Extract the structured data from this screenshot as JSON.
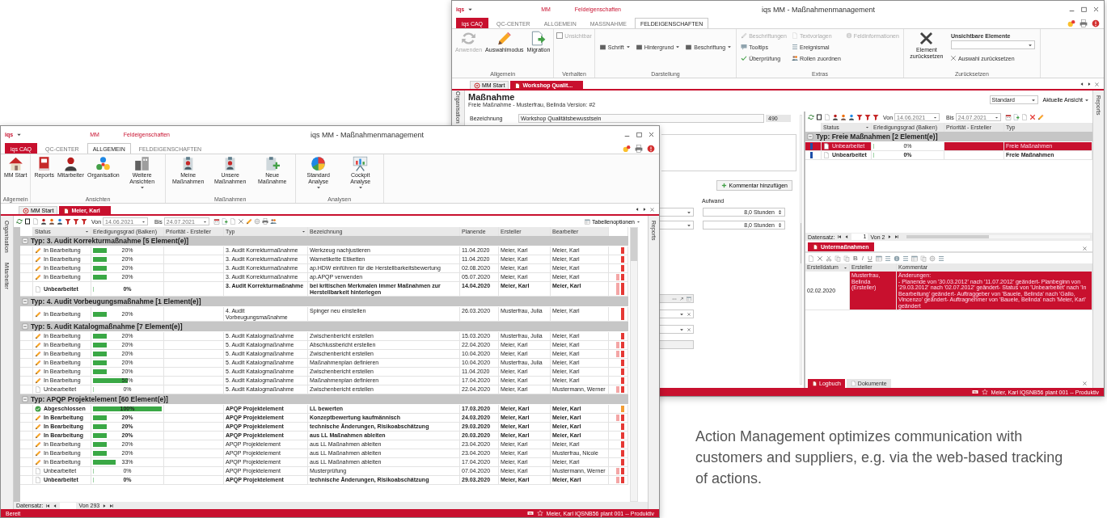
{
  "back_window": {
    "logo": "iqs",
    "context_labels": [
      "MM",
      "Feldeigenschaften"
    ],
    "title": "iqs MM - Maßnahmenmanagement",
    "ribbon_tabs": [
      {
        "label": "iqs CAQ",
        "kind": "app",
        "selected": false
      },
      {
        "label": "QC-CENTER",
        "kind": "tab",
        "selected": false
      },
      {
        "label": "ALLGEMEIN",
        "kind": "tab",
        "selected": false
      },
      {
        "label": "MASSNAHME",
        "kind": "tab",
        "selected": false
      },
      {
        "label": "FELDEIGENSCHAFTEN",
        "kind": "tab",
        "selected": true
      }
    ],
    "ribbon_groups": [
      {
        "label": "Allgemein",
        "items": [
          {
            "kind": "large",
            "label": "Anwenden",
            "disabled": true
          },
          {
            "kind": "large",
            "label": "Auswahlmodus",
            "disabled": false
          },
          {
            "kind": "large",
            "label": "Migration",
            "disabled": false
          }
        ]
      },
      {
        "label": "Verhalten",
        "items": [
          {
            "kind": "check",
            "label": "Unsichtbar",
            "checked": false,
            "disabled": true
          }
        ]
      },
      {
        "label": "Darstellung",
        "items": [
          {
            "kind": "dropdown",
            "label": "Schrift",
            "disabled": false
          },
          {
            "kind": "dropdown",
            "label": "Hintergrund",
            "disabled": false
          },
          {
            "kind": "dropdown",
            "label": "Beschriftung",
            "disabled": false
          }
        ]
      },
      {
        "label": "Extras",
        "items": [
          {
            "kind": "small",
            "label": "Beschriftungen",
            "disabled": true
          },
          {
            "kind": "small",
            "label": "Tooltips",
            "disabled": false
          },
          {
            "kind": "small",
            "label": "Überprüfung",
            "disabled": false
          },
          {
            "kind": "small",
            "label": "Textvorlagen",
            "disabled": true
          },
          {
            "kind": "small",
            "label": "Ereignismal",
            "disabled": false
          },
          {
            "kind": "small",
            "label": "Rollen zuordnen",
            "disabled": false
          },
          {
            "kind": "small",
            "label": "Feldinformationen",
            "disabled": true
          }
        ]
      },
      {
        "label": "Zurücksetzen",
        "items": [
          {
            "kind": "large",
            "label": "Element zurücksetzen",
            "disabled": false
          },
          {
            "kind": "combo",
            "label": "Unsichtbare Elemente",
            "disabled": false
          },
          {
            "kind": "small",
            "label": "Auswahl zurücksetzen",
            "disabled": false
          }
        ]
      }
    ],
    "doc_tabs": [
      {
        "label": "MM Start",
        "selected": false
      },
      {
        "label": "Workshop Qualit...",
        "selected": true
      }
    ],
    "side_tab": "Organisation",
    "right_tab": "Reports",
    "heading": "Maßnahme",
    "subtitle": "Freie Maßnahme - Musterfrau, Belinda Version: #2",
    "view_select": "Standard",
    "view_menu": "Aktuelle Ansicht",
    "form": {
      "name_label": "Bezeichnung",
      "name_value": "Workshop Qualitätsbewusstsein",
      "counter": "490",
      "add_comment": "Kommentar hinzufügen",
      "effort_label": "Aufwand",
      "effort_values": [
        "8,0 Stunden",
        "8,0 Stunden"
      ]
    },
    "grid": {
      "toolbar": {
        "from_label": "Von",
        "from": "14.06.2021",
        "to_label": "Bis",
        "to": "24.07.2021"
      },
      "columns": [
        {
          "label": "Status",
          "filter": true
        },
        {
          "label": "Erledigungsgrad (Balken)",
          "filter": false
        },
        {
          "label": "Priorität - Ersteller",
          "filter": false
        },
        {
          "label": "Typ",
          "filter": false
        }
      ],
      "group": {
        "label": "Typ: Freie Maßnahmen [2 Element(e)]",
        "expanded": true,
        "rows": [
          {
            "kind": "open",
            "status": "Unbearbeitet",
            "level": 0,
            "percent": "0%",
            "type": "Freie Maßnahmen",
            "bold": false,
            "selected": true
          },
          {
            "kind": "open",
            "status": "Unbearbeitet",
            "level": 0,
            "percent": "0%",
            "type": "Freie Maßnahmen",
            "bold": true,
            "selected": false
          }
        ]
      },
      "pager": {
        "label": "Datensatz:",
        "page": "1",
        "of": "Von 2"
      }
    },
    "sub": {
      "tab": "Untermaßnahmen",
      "format_buttons": [
        "B",
        "I",
        "U"
      ],
      "columns": [
        {
          "label": "Erstelldatum",
          "filter": true
        },
        {
          "label": "Ersteller",
          "filter": false
        },
        {
          "label": "Kommentar",
          "filter": false
        }
      ],
      "rows": [
        {
          "date": "02.02.2020",
          "creator": "Musterfrau, Belinda (Ersteller)",
          "comment": "Änderungen:\n - Planende von '30.03.2012' nach '11.07.2012' geändert- Planbeginn von '29.03.2012' nach '02.07.2012' geändert- Status von 'Unbearbeitet' nach 'In Bearbeitung' geändert- Auftraggeber von 'Bauele, Belinda' nach 'Gallo, Vincenzo' geändert- Auftragnehmer von 'Bauele, Belinda' nach 'Meier, Karl' geändert",
          "selected": true
        }
      ]
    },
    "bottom_tabs": [
      {
        "label": "Logbuch",
        "selected": true
      },
      {
        "label": "Dokumente",
        "selected": false
      }
    ],
    "status_bar": {
      "right": "Meier, Karl  IQSNB56  plant 001  --  Produktiv"
    }
  },
  "front_window": {
    "logo": "iqs",
    "context_labels": [
      "MM",
      "Feldeigenschaften"
    ],
    "title": "iqs MM - Maßnahmenmanagement",
    "ribbon_tabs": [
      {
        "label": "iqs CAQ",
        "kind": "app",
        "selected": false
      },
      {
        "label": "QC-CENTER",
        "kind": "tab",
        "selected": false
      },
      {
        "label": "ALLGEMEIN",
        "kind": "tab",
        "selected": true
      },
      {
        "label": "FELDEIGENSCHAFTEN",
        "kind": "tab",
        "selected": false
      }
    ],
    "ribbon_groups": [
      {
        "label": "Allgemein",
        "items": [
          {
            "kind": "large",
            "label": "MM Start",
            "menu": false
          }
        ]
      },
      {
        "label": "Ansichten",
        "items": [
          {
            "kind": "large",
            "label": "Reports",
            "menu": false
          },
          {
            "kind": "large",
            "label": "Mitarbeiter",
            "menu": false
          },
          {
            "kind": "large",
            "label": "Organisation",
            "menu": false
          },
          {
            "kind": "large",
            "label": "Weitere Ansichten",
            "menu": true
          }
        ]
      },
      {
        "label": "Maßnahmen",
        "items": [
          {
            "kind": "large",
            "label": "Meine Maßnahmen",
            "menu": false
          },
          {
            "kind": "large",
            "label": "Unsere Maßnahmen",
            "menu": false
          },
          {
            "kind": "large",
            "label": "Neue Maßnahme",
            "menu": false
          }
        ]
      },
      {
        "label": "Analysen",
        "items": [
          {
            "kind": "large",
            "label": "Standard Analyse",
            "menu": true
          },
          {
            "kind": "large",
            "label": "Cockpit Analyse",
            "menu": true
          }
        ]
      }
    ],
    "doc_tabs": [
      {
        "label": "MM Start",
        "selected": false
      },
      {
        "label": "Meier, Karl",
        "selected": true
      }
    ],
    "side_tabs": [
      "Organisation",
      "Mitarbeiter"
    ],
    "right_tab": "Reports",
    "toolbar": {
      "from_label": "Von",
      "from": "14.06.2021",
      "to_label": "Bis",
      "to": "24.07.2021",
      "options": "Tabellenoptionen"
    },
    "columns": [
      {
        "label": "Status",
        "filter": true
      },
      {
        "label": "Erledigungsgrad (Balken)",
        "filter": false
      },
      {
        "label": "Priorität - Ersteller",
        "filter": false
      },
      {
        "label": "Typ",
        "filter": true
      },
      {
        "label": "Bezeichnung",
        "filter": false
      },
      {
        "label": "Planende",
        "filter": false
      },
      {
        "label": "Ersteller",
        "filter": false
      },
      {
        "label": "Bearbeiter",
        "filter": false
      }
    ],
    "groups": [
      {
        "label": "Typ: 3. Audit Korrekturmaßnahme [5 Element(e)]",
        "expanded": true,
        "rows": [
          {
            "kind": "in_progress",
            "status": "In Bearbeitung",
            "level": 0.2,
            "percent": "20%",
            "type": "3. Audit Korrekturmaßnahme",
            "title": "Werkzeug nachjustieren",
            "due": "11.04.2020",
            "creator": "Meier, Karl",
            "assignee": "Meier, Karl",
            "bold": false,
            "flagged": false,
            "color": "#e53935"
          },
          {
            "kind": "in_progress",
            "status": "In Bearbeitung",
            "level": 0.2,
            "percent": "20%",
            "type": "3. Audit Korrekturmaßnahme",
            "title": "Warnetikette Etiketten",
            "due": "11.04.2020",
            "creator": "Meier, Karl",
            "assignee": "Meier, Karl",
            "bold": false,
            "flagged": false,
            "color": "#e53935"
          },
          {
            "kind": "in_progress",
            "status": "In Bearbeitung",
            "level": 0.2,
            "percent": "20%",
            "type": "3. Audit Korrekturmaßnahme",
            "title": "ap.HDW einführen für die Herstellbarkeitsbewertung",
            "due": "02.08.2020",
            "creator": "Meier, Karl",
            "assignee": "Meier, Karl",
            "bold": false,
            "flagged": false,
            "color": "#e53935"
          },
          {
            "kind": "in_progress",
            "status": "In Bearbeitung",
            "level": 0.2,
            "percent": "20%",
            "type": "3. Audit Korrekturmaßnahme",
            "title": "ap.APQP verwenden",
            "due": "05.07.2020",
            "creator": "Meier, Karl",
            "assignee": "Meier, Karl",
            "bold": false,
            "flagged": true,
            "color": "#e53935"
          },
          {
            "kind": "open",
            "status": "Unbearbeitet",
            "level": 0,
            "percent": "0%",
            "type": "3. Audit Korrekturmaßnahme",
            "title": "bei kritischen Merkmalen immer Maßnahmen zur Herstellbarkeit hinterlegen",
            "due": "14.04.2020",
            "creator": "Meier, Karl",
            "assignee": "Meier, Karl",
            "bold": true,
            "flagged": true,
            "color": "#e53935"
          }
        ]
      },
      {
        "label": "Typ: 4. Audit Vorbeugungsmaßnahme [1 Element(e)]",
        "expanded": true,
        "rows": [
          {
            "kind": "in_progress",
            "status": "In Bearbeitung",
            "level": 0.2,
            "percent": "20%",
            "type": "4. Audit Vorbeugungsmaßnahme",
            "title": "Spinger neu einstellen",
            "due": "26.03.2020",
            "creator": "Musterfrau, Julia",
            "assignee": "Meier, Karl",
            "bold": false,
            "flagged": false,
            "color": "#e53935"
          }
        ]
      },
      {
        "label": "Typ: 5. Audit Katalogmaßnahme [7 Element(e)]",
        "expanded": true,
        "rows": [
          {
            "kind": "in_progress",
            "status": "In Bearbeitung",
            "level": 0.2,
            "percent": "20%",
            "type": "5. Audit Katalogmaßnahme",
            "title": "Zwischenbericht erstellen",
            "due": "15.03.2020",
            "creator": "Musterfrau, Julia",
            "assignee": "Meier, Karl",
            "bold": false,
            "flagged": false,
            "color": "#e53935"
          },
          {
            "kind": "in_progress",
            "status": "In Bearbeitung",
            "level": 0.2,
            "percent": "20%",
            "type": "5. Audit Katalogmaßnahme",
            "title": "Abschlussbericht erstellen",
            "due": "22.04.2020",
            "creator": "Meier, Karl",
            "assignee": "Meier, Karl",
            "bold": false,
            "flagged": true,
            "color": "#e53935"
          },
          {
            "kind": "in_progress",
            "status": "In Bearbeitung",
            "level": 0.2,
            "percent": "20%",
            "type": "5. Audit Katalogmaßnahme",
            "title": "Zwischenbericht erstellen",
            "due": "10.04.2020",
            "creator": "Meier, Karl",
            "assignee": "Meier, Karl",
            "bold": false,
            "flagged": true,
            "color": "#e53935"
          },
          {
            "kind": "in_progress",
            "status": "In Bearbeitung",
            "level": 0.2,
            "percent": "20%",
            "type": "5. Audit Katalogmaßnahme",
            "title": "Maßnahmenplan definieren",
            "due": "10.04.2020",
            "creator": "Musterfrau, Julia",
            "assignee": "Meier, Karl",
            "bold": false,
            "flagged": false,
            "color": "#e53935"
          },
          {
            "kind": "in_progress",
            "status": "In Bearbeitung",
            "level": 0.2,
            "percent": "20%",
            "type": "5. Audit Katalogmaßnahme",
            "title": "Zwischenbericht erstellen",
            "due": "11.04.2020",
            "creator": "Meier, Karl",
            "assignee": "Meier, Karl",
            "bold": false,
            "flagged": false,
            "color": "#e53935"
          },
          {
            "kind": "in_progress",
            "status": "In Bearbeitung",
            "level": 0.5,
            "percent": "50%",
            "type": "5. Audit Katalogmaßnahme",
            "title": "Maßnahmenplan definieren",
            "due": "17.04.2020",
            "creator": "Meier, Karl",
            "assignee": "Meier, Karl",
            "bold": false,
            "flagged": false,
            "color": "#e53935"
          },
          {
            "kind": "open",
            "status": "Unbearbeitet",
            "level": 0,
            "percent": "0%",
            "type": "5. Audit Katalogmaßnahme",
            "title": "Zwischenbericht erstellen",
            "due": "22.04.2020",
            "creator": "Meier, Karl",
            "assignee": "Mustermann, Werner",
            "bold": false,
            "flagged": true,
            "color": "#e53935"
          }
        ]
      },
      {
        "label": "Typ: APQP Projektelement [60 Element(e)]",
        "expanded": true,
        "rows": [
          {
            "kind": "done",
            "status": "Abgeschlossen",
            "level": 1,
            "percent": "100%",
            "type": "APQP Projektelement",
            "title": "LL bewerten",
            "due": "17.03.2020",
            "creator": "Meier, Karl",
            "assignee": "Meier, Karl",
            "bold": true,
            "flagged": false,
            "color": "#f39c33"
          },
          {
            "kind": "in_progress",
            "status": "In Bearbeitung",
            "level": 0.2,
            "percent": "20%",
            "type": "APQP Projektelement",
            "title": "Konzeptbewertung kaufmännisch",
            "due": "24.03.2020",
            "creator": "Meier, Karl",
            "assignee": "Meier, Karl",
            "bold": true,
            "flagged": true,
            "color": "#e53935"
          },
          {
            "kind": "in_progress",
            "status": "In Bearbeitung",
            "level": 0.2,
            "percent": "20%",
            "type": "APQP Projektelement",
            "title": "technische Änderungen, Risikoabschätzung",
            "due": "29.03.2020",
            "creator": "Meier, Karl",
            "assignee": "Meier, Karl",
            "bold": true,
            "flagged": false,
            "color": "#e53935"
          },
          {
            "kind": "in_progress",
            "status": "In Bearbeitung",
            "level": 0.2,
            "percent": "20%",
            "type": "APQP Projektelement",
            "title": "aus LL Maßnahmen ableiten",
            "due": "20.03.2020",
            "creator": "Meier, Karl",
            "assignee": "Meier, Karl",
            "bold": true,
            "flagged": false,
            "color": "#e53935"
          },
          {
            "kind": "in_progress",
            "status": "In Bearbeitung",
            "level": 0.2,
            "percent": "20%",
            "type": "APQP Projektelement",
            "title": "aus LL Maßnahmen ableiten",
            "due": "23.04.2020",
            "creator": "Meier, Karl",
            "assignee": "Meier, Karl",
            "bold": false,
            "flagged": false,
            "color": "#e53935"
          },
          {
            "kind": "in_progress",
            "status": "In Bearbeitung",
            "level": 0.2,
            "percent": "20%",
            "type": "APQP Projektelement",
            "title": "aus LL Maßnahmen ableiten",
            "due": "23.04.2020",
            "creator": "Meier, Karl",
            "assignee": "Musterfrau, Nicole",
            "bold": false,
            "flagged": false,
            "color": "#e53935"
          },
          {
            "kind": "in_progress",
            "status": "In Bearbeitung",
            "level": 0.33,
            "percent": "33%",
            "type": "APQP Projektelement",
            "title": "aus LL Maßnahmen ableiten",
            "due": "17.04.2020",
            "creator": "Meier, Karl",
            "assignee": "Meier, Karl",
            "bold": false,
            "flagged": false,
            "color": "#e53935"
          },
          {
            "kind": "open",
            "status": "Unbearbeitet",
            "level": 0,
            "percent": "0%",
            "type": "APQP Projektelement",
            "title": "Musterprüfung",
            "due": "07.04.2020",
            "creator": "Meier, Karl",
            "assignee": "Mustermann, Werner",
            "bold": false,
            "flagged": true,
            "color": "#e53935"
          },
          {
            "kind": "open",
            "status": "Unbearbeitet",
            "level": 0,
            "percent": "0%",
            "type": "APQP Projektelement",
            "title": "technische Änderungen, Risikoabschätzung",
            "due": "29.03.2020",
            "creator": "Meier, Karl",
            "assignee": "Meier, Karl",
            "bold": true,
            "flagged": true,
            "color": "#e53935"
          }
        ]
      }
    ],
    "pager": {
      "label": "Datensatz:",
      "of": "Von 293"
    },
    "status_bar": {
      "left": "Bereit",
      "right": "Meier, Karl  IQSNB56  plant 001  --  Produktiv"
    }
  },
  "caption": "Action Management optimizes communication with customers and suppliers, e.g. via the web-based tracking of actions."
}
